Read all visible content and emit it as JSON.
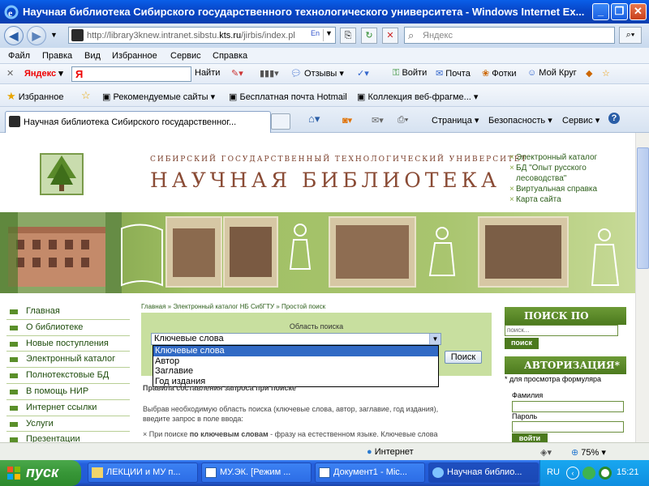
{
  "window": {
    "title": "Научная библиотека Сибирского государственного технологического университета - Windows Internet Ex...",
    "minimize": "_",
    "restore": "❐",
    "close": "✕"
  },
  "address": {
    "url_prefix": "http://library3knew.intranet.sibstu.",
    "url_host": "kts.ru",
    "url_suffix": "/jirbis/index.pl",
    "search_placeholder": "Яндекс"
  },
  "menu": [
    "Файл",
    "Правка",
    "Вид",
    "Избранное",
    "Сервис",
    "Справка"
  ],
  "yandex_toolbar": {
    "brand": "Яндекс",
    "input_value": "Я",
    "find": "Найти",
    "reviews": "Отзывы",
    "login": "Войти",
    "mail": "Почта",
    "photos": "Фотки",
    "circle": "Мой Круг"
  },
  "favorites_bar": {
    "favorites": "Избранное",
    "recommended": "Рекомендуемые сайты",
    "hotmail": "Бесплатная почта Hotmail",
    "webslices": "Коллекция веб-фрагме..."
  },
  "tab": {
    "label": "Научная библиотека Сибирского государственног...",
    "page": "Страница",
    "safety": "Безопасность",
    "service": "Сервис",
    "help": "?"
  },
  "site": {
    "header_sub": "СИБИРСКИЙ ГОСУДАРСТВЕННЫЙ ТЕХНОЛОГИЧЕСКИЙ УНИВЕРСИТЕТ",
    "header_main": "НАУЧНАЯ БИБЛИОТЕКА",
    "top_links": [
      "Электронный каталог",
      "БД \"Опыт русского лесоводства\"",
      "Виртуальная справка",
      "Карта сайта"
    ],
    "nav": [
      "Главная",
      "О библиотеке",
      "Новые поступления",
      "Электронный каталог",
      "Полнотекстовые БД",
      "В помощь НИР",
      "Интернет ссылки",
      "Услуги",
      "Презентации"
    ],
    "breadcrumb": "Главная » Электронный каталог НБ СибГТУ » Простой поиск",
    "search_area_label": "Область поиска",
    "select_value": "Ключевые слова",
    "dropdown_options": [
      "Ключевые слова",
      "Автор",
      "Заглавие",
      "Год издания"
    ],
    "search_button": "Поиск",
    "rules_title": "Правила составления запроса при поиске",
    "rules_text": "Выбрав необходимую область поиска (ключевые слова, автор, заглавие, год издания), введите запрос в поле ввода:",
    "rules_item_pre": "× При поиске ",
    "rules_item_bold": "по ключевым словам",
    "rules_item_post": " - фразу на естественном языке. Ключевые слова",
    "site_search_title": "ПОИСК ПО САЙТУ",
    "site_search_placeholder": "поиск...",
    "site_search_button": "поиск",
    "auth_title": "АВТОРИЗАЦИЯ*",
    "auth_note": "* для просмотра формуляра",
    "surname_label": "Фамилия",
    "password_label": "Пароль",
    "login_button": "войти"
  },
  "status": {
    "zone": "Интернет",
    "zoom": "75%"
  },
  "taskbar": {
    "start": "пуск",
    "buttons": [
      "ЛЕКЦИИ и МУ п...",
      "МУ.ЭК. [Режим ...",
      "Документ1 - Mic...",
      "Научная библио..."
    ],
    "lang": "RU",
    "clock": "15:21"
  },
  "colors": {
    "xp_blue": "#0a5fe8",
    "site_green": "#4c7a1e",
    "header_brown": "#8a4b35",
    "selection": "#316ac5"
  }
}
